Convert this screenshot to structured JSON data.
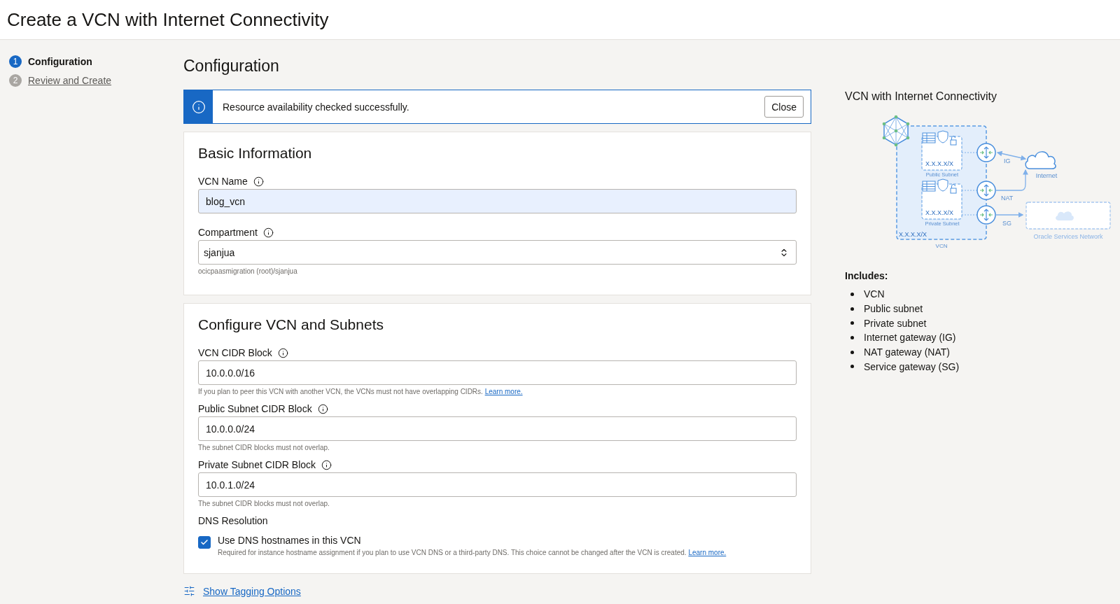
{
  "page_title": "Create a VCN with Internet Connectivity",
  "steps": [
    {
      "number": "1",
      "label": "Configuration",
      "selected": true
    },
    {
      "number": "2",
      "label": "Review and Create",
      "selected": false
    }
  ],
  "section_title": "Configuration",
  "alert": {
    "message": "Resource availability checked successfully.",
    "button": "Close"
  },
  "basic_information": {
    "title": "Basic Information",
    "vcn_name": {
      "label": "VCN Name",
      "value": "blog_vcn"
    },
    "compartment": {
      "label": "Compartment",
      "value": "sjanjua",
      "hint": "ocicpaasmigration (root)/sjanjua"
    }
  },
  "configure_vcn": {
    "title": "Configure VCN and Subnets",
    "fields": [
      {
        "label": "VCN CIDR Block",
        "value": "10.0.0.0/16",
        "hint": "If you plan to peer this VCN with another VCN, the VCNs must not have overlapping CIDRs.",
        "link": "Learn more."
      },
      {
        "label": "Public Subnet CIDR Block",
        "value": "10.0.0.0/24",
        "hint": "The subnet CIDR blocks must not overlap."
      },
      {
        "label": "Private Subnet CIDR Block",
        "value": "10.0.1.0/24",
        "hint": "The subnet CIDR blocks must not overlap."
      }
    ],
    "dns": {
      "heading": "DNS Resolution",
      "label": "Use DNS hostnames in this VCN",
      "checked": true,
      "hint": "Required for instance hostname assignment if you plan to use VCN DNS or a third-party DNS. This choice cannot be changed after the VCN is created.",
      "link": "Learn more."
    }
  },
  "tagging_link": "Show Tagging Options",
  "diagram": {
    "title": "VCN with Internet Connectivity",
    "public_cidr": "X.X.X.X/X",
    "public_label": "Public Subnet",
    "private_cidr": "X.X.X.X/X",
    "private_label": "Private Subnet",
    "vcn_cidr": "X.X.X.X/X",
    "vcn_label": "VCN",
    "ig": "IG",
    "nat": "NAT",
    "sg": "SG",
    "internet": "Internet",
    "oracle": "Oracle Services Network"
  },
  "includes": {
    "title": "Includes:",
    "items": [
      "VCN",
      "Public subnet",
      "Private subnet",
      "Internet gateway (IG)",
      "NAT gateway (NAT)",
      "Service gateway (SG)"
    ]
  }
}
